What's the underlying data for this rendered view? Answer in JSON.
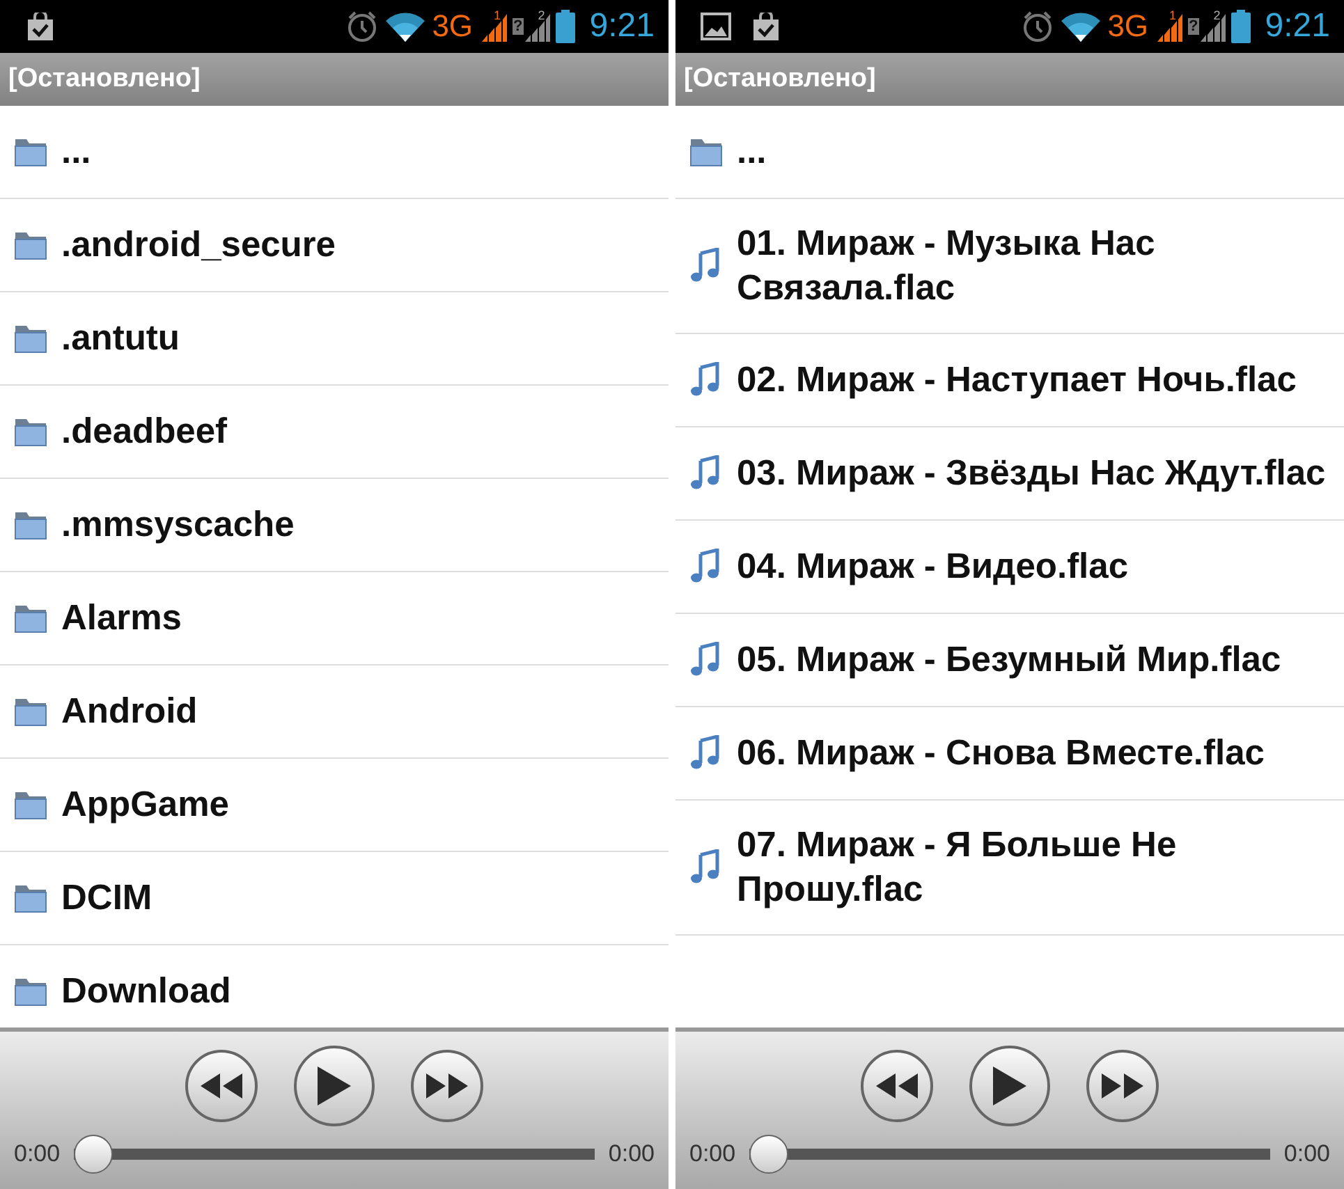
{
  "screens": [
    {
      "status_bar": {
        "notifications": [
          {
            "kind": "task"
          }
        ],
        "network": "3G",
        "sim1": "1",
        "sim2": "2",
        "sim2_status": "?",
        "time": "9:21"
      },
      "header": {
        "title": "[Остановлено]"
      },
      "items": [
        {
          "kind": "folder",
          "name": "..."
        },
        {
          "kind": "folder",
          "name": ".android_secure"
        },
        {
          "kind": "folder",
          "name": ".antutu"
        },
        {
          "kind": "folder",
          "name": ".deadbeef"
        },
        {
          "kind": "folder",
          "name": ".mmsyscache"
        },
        {
          "kind": "folder",
          "name": "Alarms"
        },
        {
          "kind": "folder",
          "name": "Android"
        },
        {
          "kind": "folder",
          "name": "AppGame"
        },
        {
          "kind": "folder",
          "name": "DCIM"
        },
        {
          "kind": "folder",
          "name": "Download"
        }
      ],
      "player": {
        "elapsed": "0:00",
        "total": "0:00",
        "level": 0
      }
    },
    {
      "status_bar": {
        "notifications": [
          {
            "kind": "image"
          },
          {
            "kind": "task"
          }
        ],
        "network": "3G",
        "sim1": "1",
        "sim2": "2",
        "sim2_status": "?",
        "time": "9:21"
      },
      "header": {
        "title": "[Остановлено]"
      },
      "items": [
        {
          "kind": "folder",
          "name": "..."
        },
        {
          "kind": "audio",
          "name": "01. Мираж - Музыка Нас Связала.flac"
        },
        {
          "kind": "audio",
          "name": "02. Мираж - Наступает Ночь.flac"
        },
        {
          "kind": "audio",
          "name": "03. Мираж - Звёзды Нас Ждут.flac"
        },
        {
          "kind": "audio",
          "name": "04. Мираж - Видео.flac"
        },
        {
          "kind": "audio",
          "name": "05. Мираж - Безумный Мир.flac"
        },
        {
          "kind": "audio",
          "name": "06. Мираж - Снова Вместе.flac"
        },
        {
          "kind": "audio",
          "name": "07. Мираж - Я Больше Не Прошу.flac"
        }
      ],
      "player": {
        "elapsed": "0:00",
        "total": "0:00",
        "level": 0
      }
    }
  ]
}
